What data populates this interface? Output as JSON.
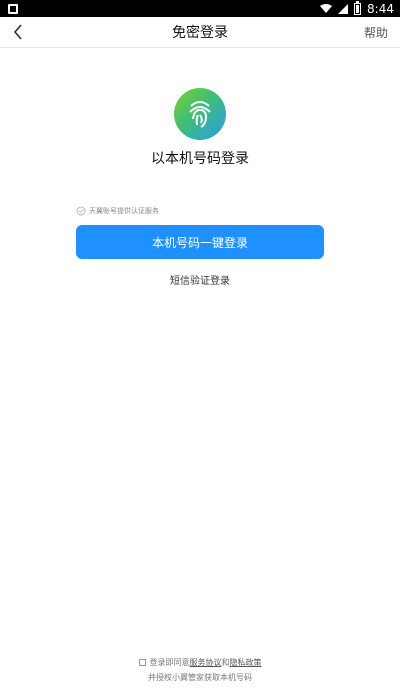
{
  "status_bar": {
    "time": "8:44"
  },
  "header": {
    "title": "免密登录",
    "help": "帮助"
  },
  "main": {
    "subtitle": "以本机号码登录",
    "service_note": "天翼账号提供认证服务",
    "primary_button": "本机号码一键登录",
    "sms_login": "短信验证登录"
  },
  "footer": {
    "line1_prefix": "登录即同意",
    "service_agreement": "服务协议",
    "and": "和",
    "privacy_policy": "隐私政策",
    "line2": "并授权小翼管家获取本机号码"
  },
  "colors": {
    "primary": "#1e90ff",
    "logo_gradient": [
      "#7ad12c",
      "#3fbd77",
      "#2a9cf0"
    ]
  }
}
